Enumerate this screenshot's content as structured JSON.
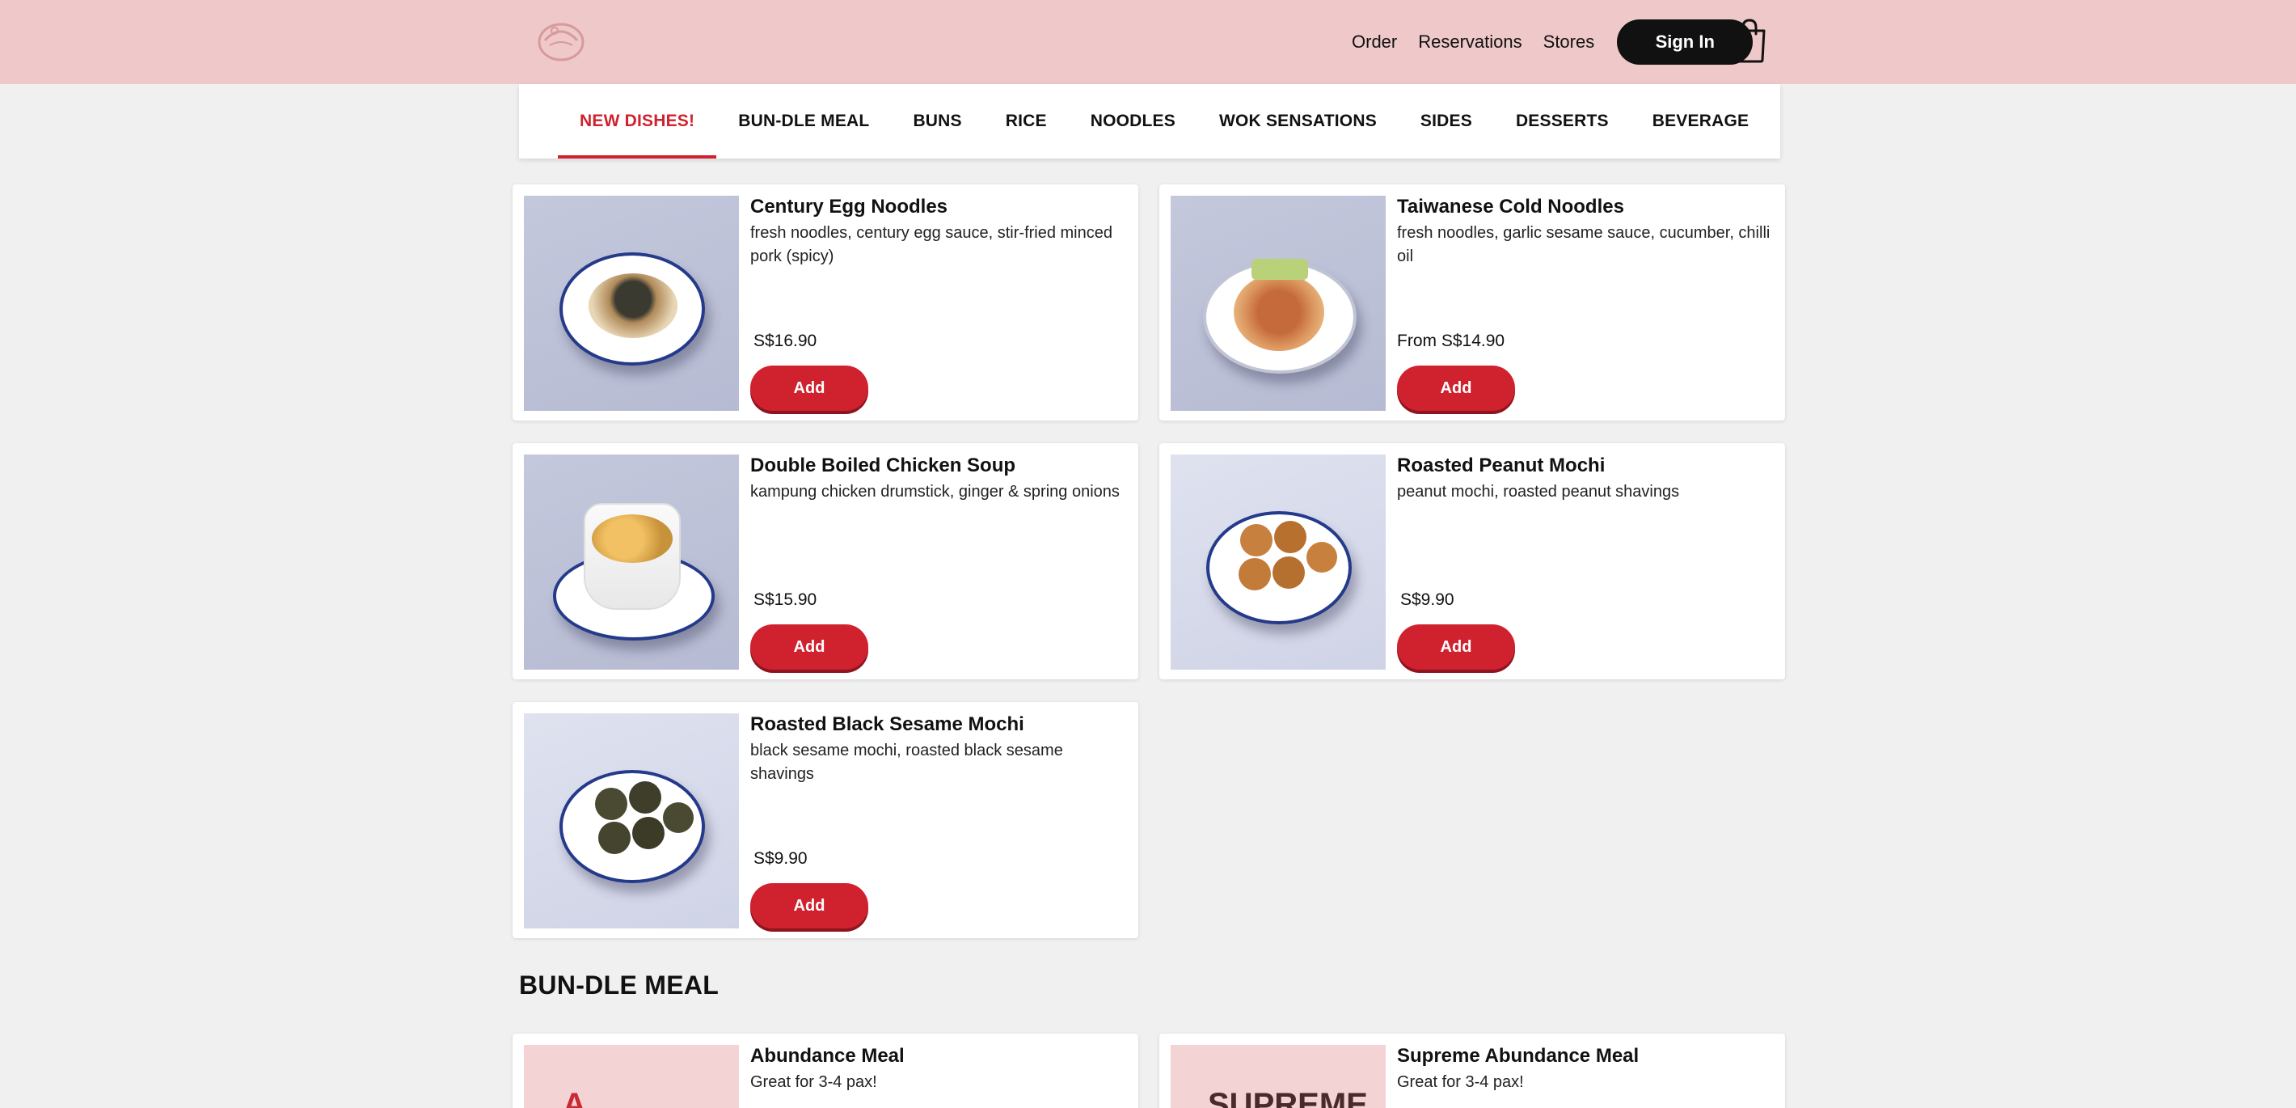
{
  "header": {
    "nav": [
      "Order",
      "Reservations",
      "Stores"
    ],
    "sign_in": "Sign In"
  },
  "tabs": [
    "NEW DISHES!",
    "BUN-DLE MEAL",
    "BUNS",
    "RICE",
    "NOODLES",
    "WOK SENSATIONS",
    "SIDES",
    "DESSERTS",
    "BEVERAGE"
  ],
  "active_tab": "NEW DISHES!",
  "new_dishes": [
    {
      "name": "Century Egg Noodles",
      "desc": "fresh noodles, century egg sauce, stir-fried minced pork (spicy)",
      "price": "S$16.90",
      "add": "Add"
    },
    {
      "name": "Taiwanese Cold Noodles",
      "desc": "fresh noodles, garlic sesame sauce, cucumber, chilli oil",
      "price": "From S$14.90",
      "add": "Add"
    },
    {
      "name": "Double Boiled Chicken Soup",
      "desc": "kampung chicken drumstick, ginger & spring onions",
      "price": "S$15.90",
      "add": "Add"
    },
    {
      "name": "Roasted Peanut Mochi",
      "desc": "peanut mochi, roasted peanut shavings",
      "price": "S$9.90",
      "add": "Add"
    },
    {
      "name": "Roasted Black Sesame Mochi",
      "desc": "black sesame mochi, roasted black sesame shavings",
      "price": "S$9.90",
      "add": "Add"
    }
  ],
  "bundle_section_title": "BUN-DLE MEAL",
  "bundle_meals": [
    {
      "name": "Abundance Meal",
      "desc": "Great for 3-4 pax!",
      "promo_text": "A"
    },
    {
      "name": "Supreme Abundance Meal",
      "desc": "Great for 3-4 pax!",
      "promo_text": "SUPREME"
    }
  ],
  "colors": {
    "header_bg": "#efc8c9",
    "accent_red": "#d0222e",
    "page_bg": "#f0f0f0"
  }
}
